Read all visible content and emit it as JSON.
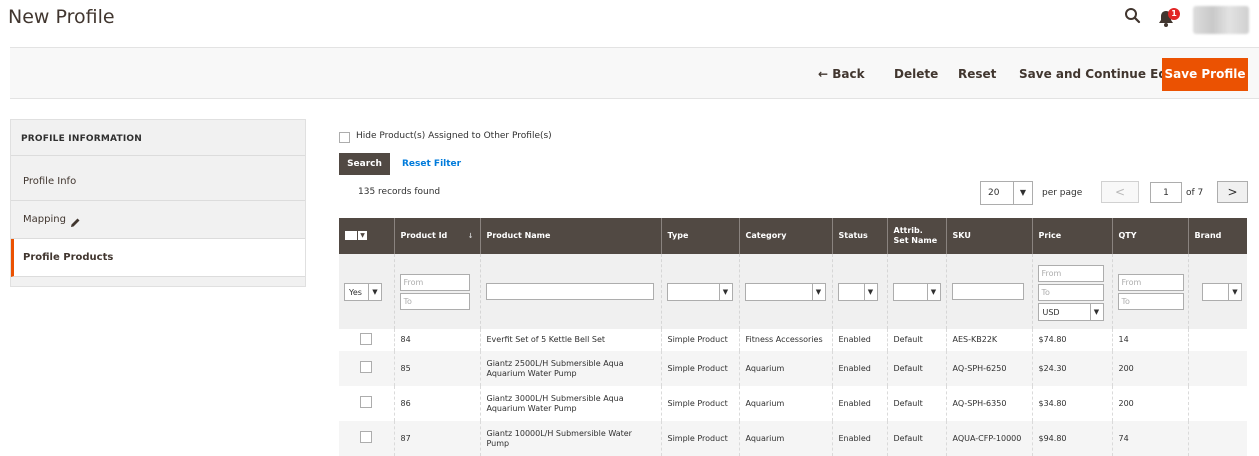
{
  "header": {
    "title": "New Profile",
    "notification_count": "1"
  },
  "actions": {
    "back": "← Back",
    "delete": "Delete",
    "reset": "Reset",
    "save_continue": "Save and Continue Edit",
    "save_profile": "Save Profile"
  },
  "sidebar": {
    "header": "PROFILE INFORMATION",
    "items": [
      {
        "label": "Profile Info"
      },
      {
        "label": "Mapping"
      },
      {
        "label": "Profile Products"
      }
    ],
    "active": "Profile Products"
  },
  "filters": {
    "hide_label": "Hide Product(s) Assigned to Other Profile(s)",
    "search_btn": "Search",
    "reset_filter": "Reset Filter",
    "records": "135 records found",
    "per_page_value": "20",
    "per_page_label": "per page",
    "page_current": "1",
    "page_total": "of 7"
  },
  "grid": {
    "columns": [
      "",
      "Product Id",
      "Product Name",
      "Type",
      "Category",
      "Status",
      "Attrib. Set Name",
      "SKU",
      "Price",
      "QTY",
      "Brand"
    ],
    "filter_row": {
      "selected": "Yes",
      "from_placeholder": "From",
      "to_placeholder": "To",
      "currency": "USD"
    },
    "rows": [
      {
        "id": "84",
        "name": "Everfit Set of 5 Kettle Bell Set",
        "type": "Simple Product",
        "category": "Fitness Accessories",
        "status": "Enabled",
        "attrib_set": "Default",
        "sku": "AES-KB22K",
        "price": "$74.80",
        "qty": "14",
        "brand": ""
      },
      {
        "id": "85",
        "name": "Giantz 2500L/H Submersible Aqua Aquarium Water Pump",
        "type": "Simple Product",
        "category": "Aquarium",
        "status": "Enabled",
        "attrib_set": "Default",
        "sku": "AQ-SPH-6250",
        "price": "$24.30",
        "qty": "200",
        "brand": ""
      },
      {
        "id": "86",
        "name": "Giantz 3000L/H Submersible Aqua Aquarium Water Pump",
        "type": "Simple Product",
        "category": "Aquarium",
        "status": "Enabled",
        "attrib_set": "Default",
        "sku": "AQ-SPH-6350",
        "price": "$34.80",
        "qty": "200",
        "brand": ""
      },
      {
        "id": "87",
        "name": "Giantz 10000L/H Submersible Water Pump",
        "type": "Simple Product",
        "category": "Aquarium",
        "status": "Enabled",
        "attrib_set": "Default",
        "sku": "AQUA-CFP-10000",
        "price": "$94.80",
        "qty": "74",
        "brand": ""
      }
    ]
  },
  "colors": {
    "accent": "#eb5202",
    "grid_header": "#514943",
    "link": "#007bdb"
  },
  "icons": [
    "search-icon",
    "bell-icon",
    "pencil-icon"
  ]
}
